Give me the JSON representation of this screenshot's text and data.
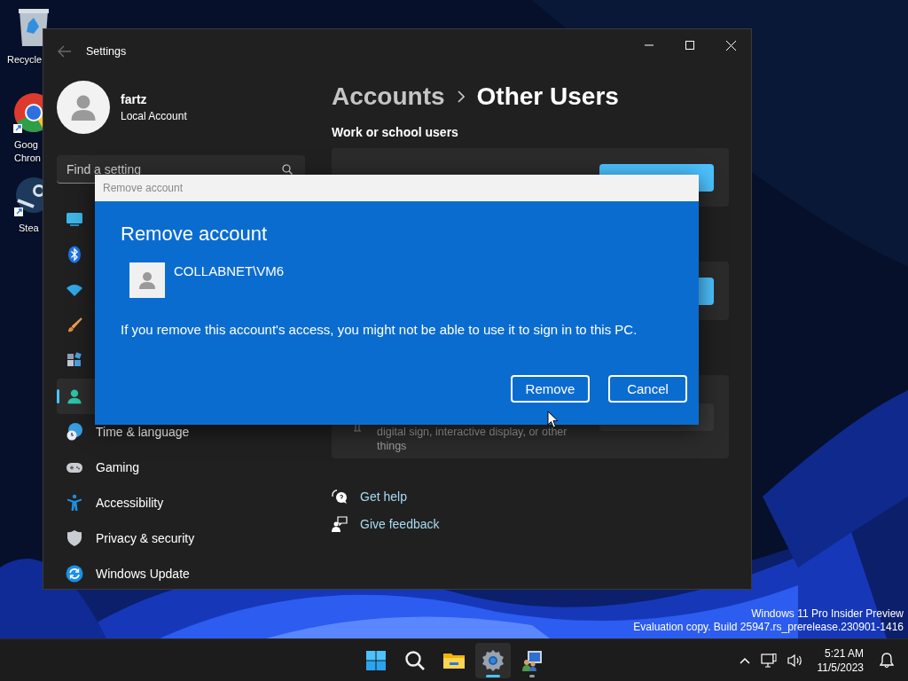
{
  "desktop": {
    "icons": [
      {
        "label": "Recycle"
      },
      {
        "label": "Goog\nChron"
      },
      {
        "label": "Stea"
      }
    ],
    "watermark": [
      "Windows 11 Pro Insider Preview",
      "Evaluation copy. Build 25947.rs_prerelease.230901-1416"
    ]
  },
  "settings_window": {
    "title": "Settings",
    "account": {
      "name": "fartz",
      "type": "Local Account"
    },
    "search": {
      "placeholder": "Find a setting"
    },
    "nav": [
      {
        "selected": false
      },
      {
        "selected": false
      },
      {
        "selected": false
      },
      {
        "selected": false
      },
      {
        "selected": false
      },
      {
        "selected": true
      },
      {
        "label": "Time & language",
        "selected": false
      },
      {
        "label": "Gaming",
        "selected": false
      },
      {
        "label": "Accessibility",
        "selected": false
      },
      {
        "label": "Privacy & security",
        "selected": false
      },
      {
        "label": "Windows Update",
        "selected": false
      }
    ],
    "breadcrumb": [
      "Accounts",
      "Other Users"
    ],
    "section_title": "Work or school users",
    "card_text": "digital sign, interactive display, or other things",
    "links": [
      "Get help",
      "Give feedback"
    ]
  },
  "dialog": {
    "title": "Remove account",
    "heading": "Remove account",
    "account": "COLLABNET\\VM6",
    "message": "If you remove this account's access, you might not be able to use it to sign in to this PC.",
    "buttons": [
      "Remove",
      "Cancel"
    ]
  },
  "taskbar": {
    "apps": [
      {
        "selected": false,
        "running": false
      },
      {
        "selected": false,
        "running": false
      },
      {
        "selected": false,
        "running": false
      },
      {
        "selected": true,
        "running": true
      },
      {
        "selected": false,
        "running": true
      }
    ],
    "time": "5:21 AM",
    "date": "11/5/2023"
  }
}
